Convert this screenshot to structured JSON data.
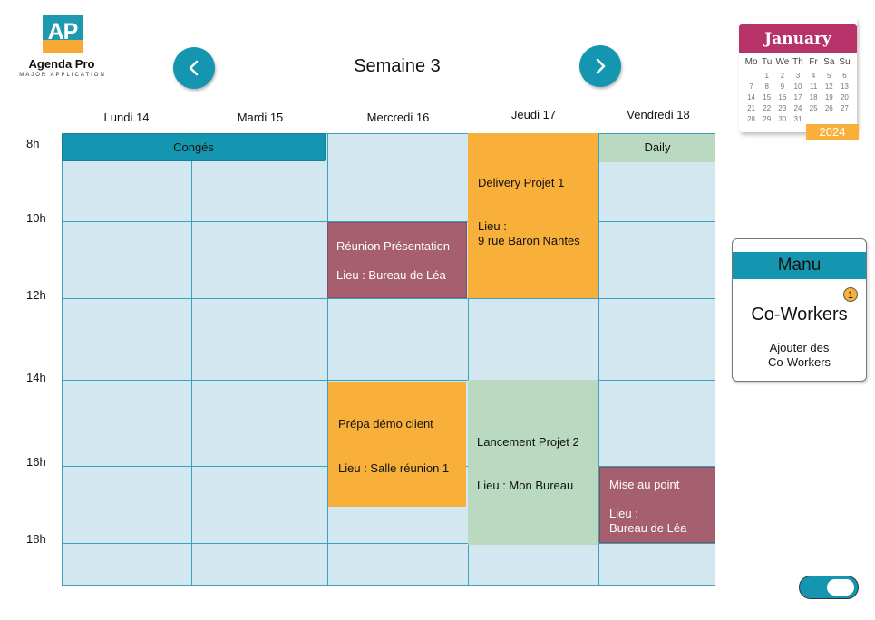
{
  "logo": {
    "mark": "AP",
    "name": "Agenda Pro",
    "tagline": "MAJOR APPLICATION"
  },
  "header": {
    "week_title": "Semaine 3"
  },
  "days": [
    "Lundi 14",
    "Mardi 15",
    "Mercredi 16",
    "Jeudi 17",
    "Vendredi 18"
  ],
  "hours": [
    "8h",
    "10h",
    "12h",
    "14h",
    "16h",
    "18h"
  ],
  "events": {
    "conges": {
      "title": "Congés"
    },
    "daily": {
      "title": "Daily"
    },
    "delivery": {
      "title": "Delivery Projet 1",
      "lieu_label": "Lieu :",
      "lieu": "9 rue Baron Nantes"
    },
    "reunion": {
      "title": "Réunion Présentation",
      "lieu": "Lieu : Bureau de Léa"
    },
    "prepa": {
      "title": "Prépa démo client",
      "lieu": "Lieu : Salle réunion 1"
    },
    "lancement": {
      "title": "Lancement Projet 2",
      "lieu": "Lieu : Mon Bureau"
    },
    "mise": {
      "title": "Mise au point",
      "lieu_label": "Lieu :",
      "lieu": "Bureau de Léa"
    }
  },
  "mini_calendar": {
    "month": "January",
    "year": "2024",
    "dow": [
      "Mo",
      "Tu",
      "We",
      "Th",
      "Fr",
      "Sa",
      "Su"
    ],
    "days": [
      "",
      "1",
      "2",
      "3",
      "4",
      "5",
      "6",
      "7",
      "8",
      "9",
      "10",
      "11",
      "12",
      "13",
      "14",
      "15",
      "16",
      "17",
      "18",
      "19",
      "20",
      "21",
      "22",
      "23",
      "24",
      "25",
      "26",
      "27",
      "28",
      "29",
      "30",
      "31",
      "",
      "",
      ""
    ]
  },
  "coworkers": {
    "user": "Manu",
    "badge_count": "1",
    "title": "Co-Workers",
    "add_line1": "Ajouter des",
    "add_line2": "Co-Workers"
  },
  "colors": {
    "teal": "#1596b0",
    "orange": "#f8b03b",
    "mauve": "#a65f6e",
    "mint": "#b9d9c1",
    "grid_bg": "#d2e7ef",
    "calendar_header": "#b8326a"
  }
}
